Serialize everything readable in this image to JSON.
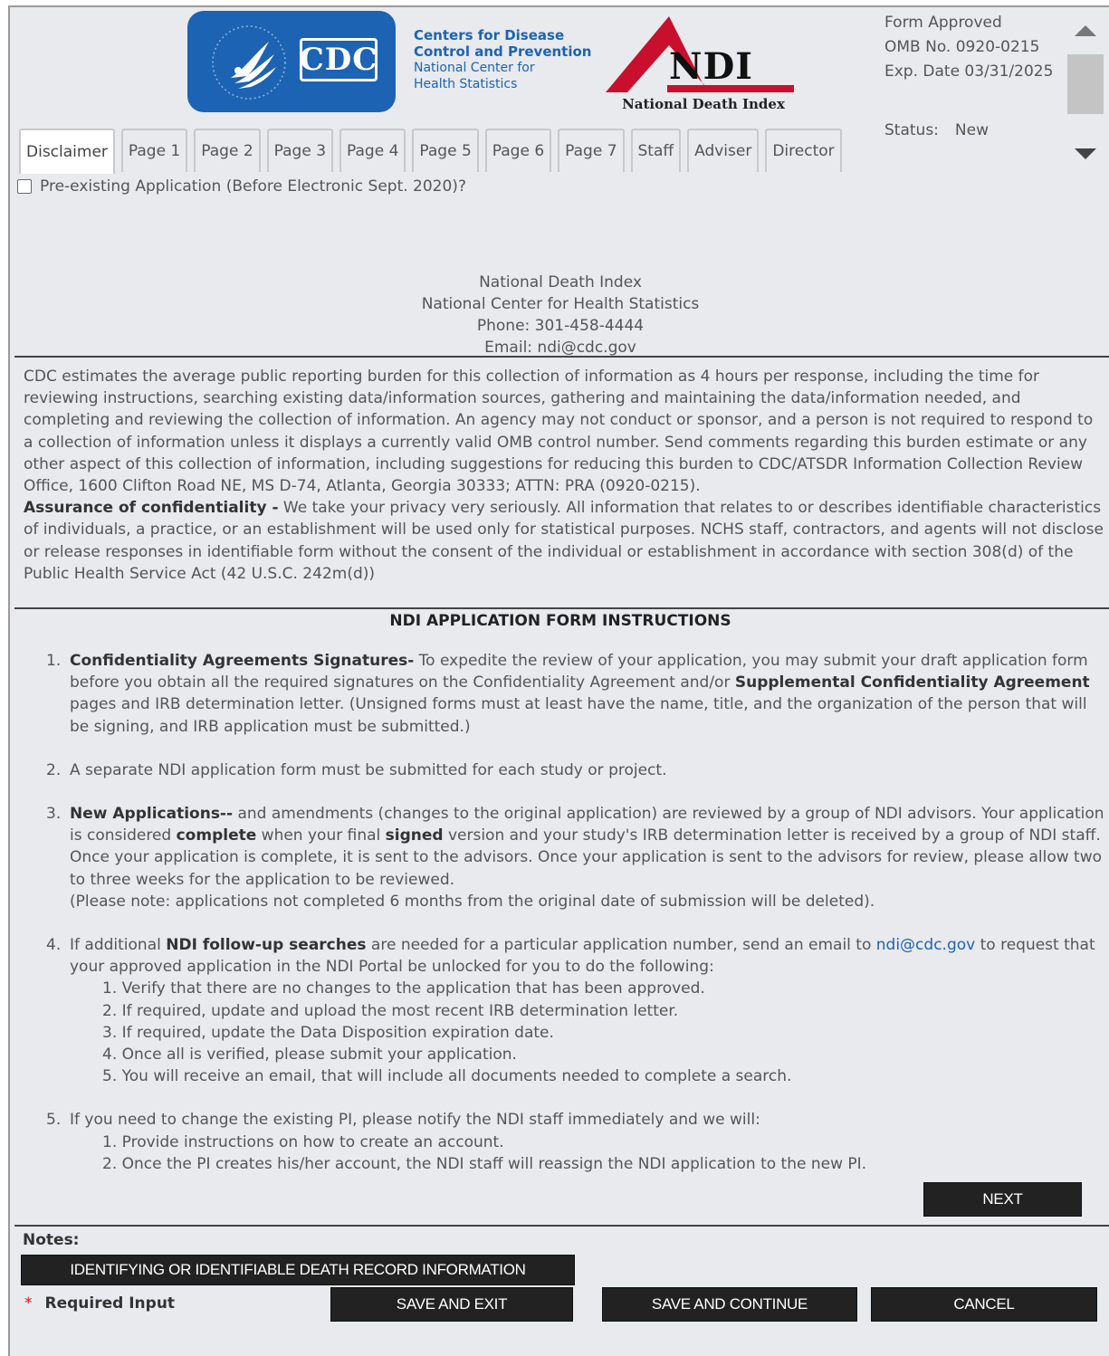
{
  "header": {
    "cdc_logo_text": "CDC",
    "cdc_line1": "Centers for Disease",
    "cdc_line2": "Control and Prevention",
    "cdc_line3": "National Center for",
    "cdc_line4": "Health Statistics",
    "ndi_logo_text": "NDI",
    "ndi_subtitle": "National Death Index",
    "form_approved": "Form Approved",
    "omb_no": "OMB No. 0920-0215",
    "exp_date": "Exp. Date 03/31/2025",
    "status_label": "Status:",
    "status_value": "New"
  },
  "tabs": [
    "Disclaimer",
    "Page 1",
    "Page 2",
    "Page 3",
    "Page 4",
    "Page 5",
    "Page 6",
    "Page 7",
    "Staff",
    "Adviser",
    "Director"
  ],
  "active_tab": "Disclaimer",
  "preexisting_label": "Pre-existing Application (Before Electronic Sept. 2020)?",
  "contact": {
    "line1": "National Death Index",
    "line2": "National Center for Health Statistics",
    "line3": "Phone: 301-458-4444",
    "line4": "Email: ndi@cdc.gov"
  },
  "burden_text": "CDC estimates the average public reporting burden for this collection of information as 4 hours per response, including the time for reviewing instructions, searching existing data/information sources, gathering and maintaining the data/information needed, and completing and reviewing the collection of information. An agency may not conduct or sponsor, and a person is not required to respond to a collection of information unless it displays a currently valid OMB control number. Send comments regarding this burden estimate or any other aspect of this collection of information, including suggestions for reducing this burden to CDC/ATSDR Information Collection Review Office, 1600 Clifton Road NE, MS D-74, Atlanta, Georgia 30333; ATTN: PRA (0920-0215).",
  "assurance_title": "Assurance of confidentiality -",
  "assurance_text": " We take your privacy very seriously. All information that relates to or describes identifiable characteristics of individuals, a practice, or an establishment will be used only for statistical purposes. NCHS staff, contractors, and agents will not disclose or release responses in identifiable form without the consent of the individual or establishment in accordance with section 308(d) of the Public Health Service Act (42 U.S.C. 242m(d))",
  "instructions_title": "NDI APPLICATION FORM INSTRUCTIONS",
  "instructions": {
    "i1_num": "1.",
    "i1_bold": "Confidentiality Agreements Signatures-",
    "i1_text1": " To expedite the review of your application, you may submit your draft application form before you obtain all the required signatures on the Confidentiality Agreement and/or ",
    "i1_bold2": "Supplemental Confidentiality Agreement",
    "i1_text2": " pages and IRB determination letter. (Unsigned forms must at least have the name, title, and the organization of the person that will be signing, and IRB application must be submitted.)",
    "i2_num": "2.",
    "i2_text": "A separate NDI application form must be submitted for each study or project.",
    "i3_num": "3.",
    "i3_bold": "New Applications--",
    "i3_text1": " and amendments (changes to the original application) are reviewed by a group of NDI advisors. Your application is considered ",
    "i3_bold2": "complete",
    "i3_text2": " when your final ",
    "i3_bold3": "signed",
    "i3_text3": " version and your study's IRB determination letter is received by a group of NDI staff. Once your application is complete, it is sent to the advisors. Once your application is sent to the advisors for review, please allow two to three weeks for the application to be reviewed.",
    "i3_note": "(Please note: applications not completed 6 months from the original date of submission will be deleted).",
    "i4_num": "4.",
    "i4_text1": "If additional ",
    "i4_bold": "NDI follow-up searches",
    "i4_text2": " are needed for a particular application number, send an email to ",
    "i4_link": "ndi@cdc.gov",
    "i4_text3": " to request that your approved application in the NDI Portal be unlocked for you to do the following:",
    "i4_subs": [
      "1. Verify that there are no changes to the application that has been approved.",
      "2. If required, update and upload the most recent IRB determination letter.",
      "3. If required, update the Data Disposition expiration date.",
      "4. Once all is verified, please submit your application.",
      "5. You will receive an email, that will include all documents needed to complete a search."
    ],
    "i5_num": "5.",
    "i5_text": "If you need to change the existing PI, please notify the NDI staff immediately and we will:",
    "i5_subs": [
      "1. Provide instructions on how to create an account.",
      "2. Once the PI creates his/her account, the NDI staff will reassign the NDI application to the new PI."
    ]
  },
  "buttons": {
    "next": "NEXT",
    "identifying": "IDENTIFYING OR IDENTIFIABLE DEATH RECORD INFORMATION",
    "save_exit": "SAVE AND EXIT",
    "save_continue": "SAVE AND CONTINUE",
    "cancel": "CANCEL"
  },
  "notes_label": "Notes:",
  "required_star": "*",
  "required_label": "Required Input"
}
